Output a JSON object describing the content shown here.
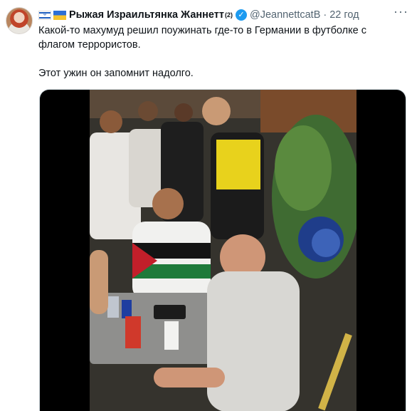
{
  "tweet": {
    "author": {
      "flags": [
        "israel-flag",
        "ukraine-flag"
      ],
      "display_name": "Рыжая Израильтянка Жаннетт",
      "superscript": "(2)",
      "handle": "@JeannettcatB",
      "verified": true,
      "time": "22 год"
    },
    "text_line_1": "Какой-то махумуд решил поужинать  где-то в Германии в футболке с",
    "text_line_2": "флагом террористов.",
    "text_line_3": "Этот ужин он запомнит надолго.",
    "more_menu": "···",
    "media": {
      "type": "video",
      "colors": {
        "letterbox": "#000000",
        "border": "#cfd9de"
      }
    }
  },
  "colors": {
    "text_primary": "#0f1419",
    "text_secondary": "#536471",
    "verified_blue": "#1d9bf0",
    "background": "#ffffff"
  }
}
